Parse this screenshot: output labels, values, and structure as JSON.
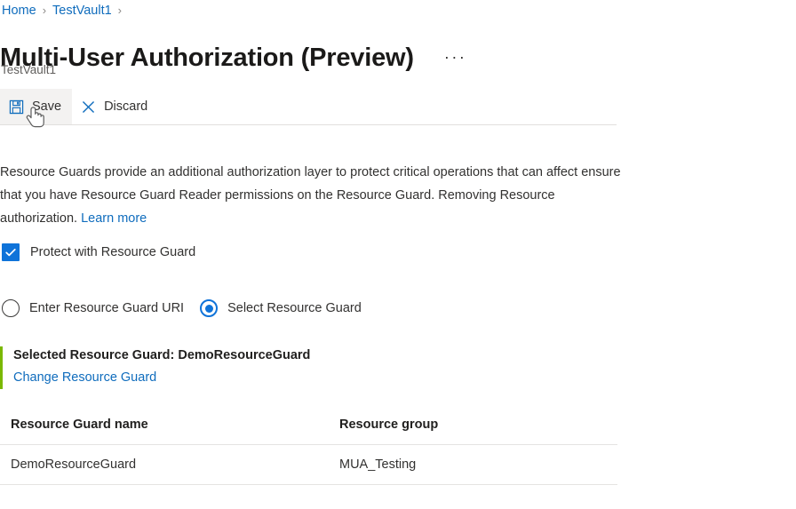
{
  "breadcrumb": {
    "items": [
      {
        "label": "Home",
        "icon": "none"
      },
      {
        "label": "TestVault1",
        "icon": "none"
      }
    ],
    "separator": "›"
  },
  "header": {
    "title": "Multi-User Authorization (Preview)",
    "subtitle": "TestVault1",
    "more_menu": "···"
  },
  "commandbar": {
    "save": {
      "label": "Save",
      "icon": "save-icon",
      "state": "hovered"
    },
    "discard": {
      "label": "Discard",
      "icon": "close-icon",
      "state": "default"
    }
  },
  "description": {
    "text": "Resource Guards provide an additional authorization layer to protect critical operations that can affect ensure that you have Resource Guard Reader permissions on the Resource Guard. Removing Resource authorization. ",
    "link_label": "Learn more"
  },
  "protect_checkbox": {
    "label": "Protect with Resource Guard",
    "checked": true,
    "check_glyph": "✓"
  },
  "guard_mode": {
    "options": [
      {
        "label": "Enter Resource Guard URI",
        "selected": false
      },
      {
        "label": "Select Resource Guard",
        "selected": true
      }
    ]
  },
  "selected_guard": {
    "title": "Selected Resource Guard: DemoResourceGuard",
    "change_link": "Change Resource Guard"
  },
  "guard_table": {
    "columns": [
      "Resource Guard name",
      "Resource group"
    ],
    "rows": [
      {
        "name": "DemoResourceGuard",
        "group": "MUA_Testing"
      }
    ]
  },
  "colors": {
    "link": "#0f6cbd",
    "accent_blue": "#0f73d9",
    "green_bar": "#7ab800",
    "text": "#323130",
    "border": "#e5e4e2"
  }
}
